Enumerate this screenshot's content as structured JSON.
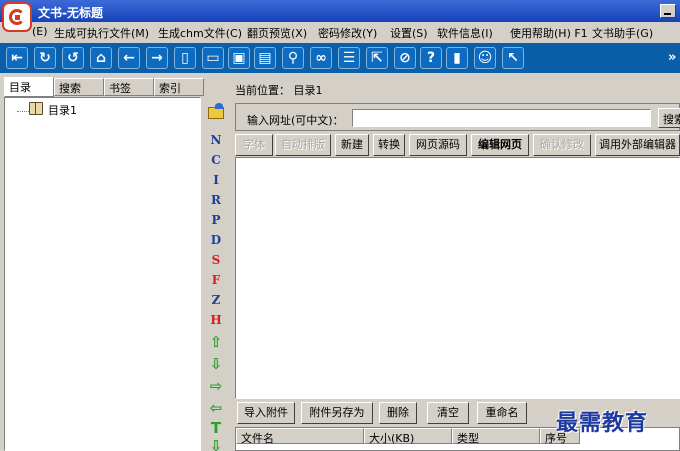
{
  "window": {
    "title": "文书-无标题"
  },
  "menu": [
    "(E)",
    "生成可执行文件(M)",
    "生成chm文件(C)",
    "翻页预览(X)",
    "密码修改(Y)",
    "设置(S)",
    "软件信息(I)",
    "使用帮助(H) F1",
    "文书助手(G)"
  ],
  "toolbar": {
    "icons": [
      "import-icon",
      "refresh-icon",
      "undo-icon",
      "home-icon",
      "back-icon",
      "forward-icon",
      "new-page-icon",
      "open-icon",
      "save-icon",
      "save-as-icon",
      "search-icon",
      "link-icon",
      "document-icon",
      "export-icon",
      "compass-icon",
      "help-icon",
      "bookmark-icon",
      "smiley-icon",
      "cursor-icon"
    ],
    "overflow": "»"
  },
  "left_tabs": [
    "目录",
    "搜索",
    "书签",
    "索引"
  ],
  "tree": {
    "root_label": "目录1"
  },
  "vertical_buttons": [
    "N",
    "C",
    "I",
    "R",
    "P",
    "D",
    "S",
    "F",
    "Z",
    "H",
    "⇧",
    "⇩",
    "⇨",
    "⇦",
    "T",
    "⇩"
  ],
  "location": {
    "text": "当前位置： 目录1"
  },
  "url": {
    "label": "输入网址(可中文)：",
    "value": "",
    "search_button": "搜索"
  },
  "editor_buttons": [
    {
      "label": "字体",
      "disabled": true
    },
    {
      "label": "自动排版",
      "disabled": true
    },
    {
      "label": "新建",
      "disabled": false
    },
    {
      "label": "转换",
      "disabled": false
    },
    {
      "label": "网页源码",
      "disabled": false
    },
    {
      "label": "编辑网页",
      "disabled": false,
      "bold": true
    },
    {
      "label": "确认修改",
      "disabled": true
    },
    {
      "label": "调用外部编辑器",
      "disabled": false
    }
  ],
  "attachment_buttons": [
    "导入附件",
    "附件另存为",
    "删除",
    "清空",
    "重命名"
  ],
  "attachment_columns": [
    "文件名",
    "大小(KB)",
    "类型",
    "序号"
  ],
  "watermark": "最需教育"
}
